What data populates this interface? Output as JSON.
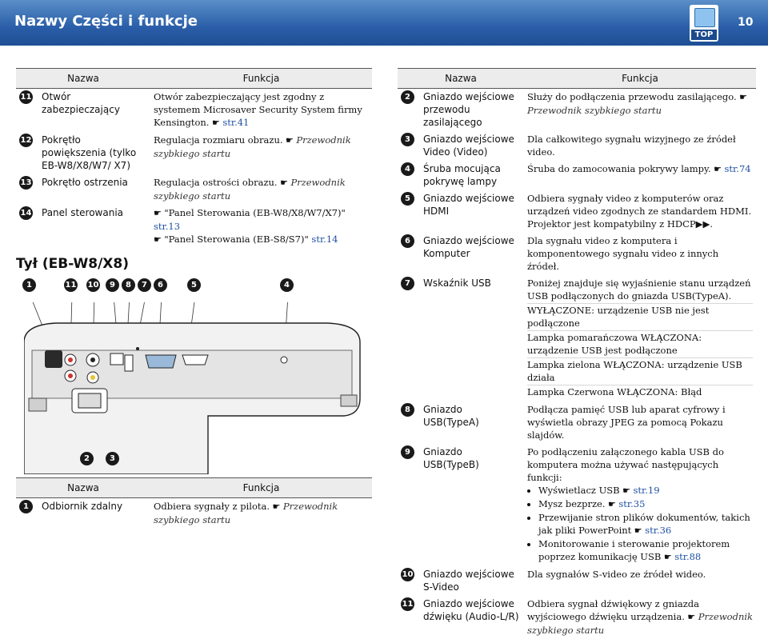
{
  "header": {
    "title": "Nazwy Części i funkcje",
    "page": "10",
    "top_label": "TOP"
  },
  "left_table": {
    "col_name": "Nazwa",
    "col_func": "Funkcja",
    "rows": [
      {
        "num": "11",
        "name": "Otwór zabezpieczający",
        "func": "Otwór zabezpieczający jest zgodny z systemem Microsaver Security System firmy Kensington.",
        "link": "str.41"
      },
      {
        "num": "12",
        "name": "Pokrętło powiększenia (tylko EB-W8/X8/W7/ X7)",
        "func": "Regulacja rozmiaru obrazu.",
        "italic": "Przewodnik szybkiego startu"
      },
      {
        "num": "13",
        "name": "Pokrętło ostrzenia",
        "func": "Regulacja ostrości obrazu.",
        "italic": "Przewodnik szybkiego startu"
      },
      {
        "num": "14",
        "name": "Panel sterowania",
        "func1": "\"Panel Sterowania (EB-W8/X8/W7/X7)\"",
        "link1": "str.13",
        "func2": "\"Panel Sterowania (EB-S8/S7)\"",
        "link2": "str.14"
      }
    ]
  },
  "section_title": "Tył (EB-W8/X8)",
  "callouts": [
    "1",
    "11",
    "10",
    "9",
    "8",
    "7",
    "6",
    "5",
    "4",
    "2",
    "3"
  ],
  "bottom_table": {
    "col_name": "Nazwa",
    "col_func": "Funkcja",
    "rows": [
      {
        "num": "1",
        "name": "Odbiornik zdalny",
        "func": "Odbiera sygnały z pilota.",
        "italic": "Przewodnik szybkiego startu"
      }
    ]
  },
  "right_table": {
    "col_name": "Nazwa",
    "col_func": "Funkcja",
    "rows": [
      {
        "num": "2",
        "name": "Gniazdo wejściowe przewodu zasilającego",
        "func": "Służy do podłączenia przewodu zasilającego.",
        "italic": "Przewodnik szybkiego startu"
      },
      {
        "num": "3",
        "name": "Gniazdo wejściowe Video (Video)",
        "func": "Dla całkowitego sygnału wizyjnego ze źródeł video."
      },
      {
        "num": "4",
        "name": "Śruba mocująca pokrywę lampy",
        "func": "Śruba do zamocowania pokrywy lampy.",
        "link": "str.74"
      },
      {
        "num": "5",
        "name": "Gniazdo wejściowe HDMI",
        "func": "Odbiera sygnały video z komputerów oraz urządzeń video zgodnych ze standardem HDMI. Projektor jest kompatybilny z HDCP",
        "suffix": "."
      },
      {
        "num": "6",
        "name": "Gniazdo wejściowe Komputer",
        "func": "Dla sygnału video z komputera i komponentowego sygnału video z innych źródeł."
      },
      {
        "num": "7",
        "name": "Wskaźnik USB",
        "subs": [
          "Poniżej znajduje się wyjaśnienie stanu urządzeń USB podłączonych do gniazda USB(TypeA).",
          "WYŁĄCZONE: urządzenie USB nie jest podłączone",
          "Lampka pomarańczowa WŁĄCZONA: urządzenie USB jest podłączone",
          "Lampka zielona WŁĄCZONA: urządzenie USB działa",
          "Lampka Czerwona WŁĄCZONA: Błąd"
        ]
      },
      {
        "num": "8",
        "name": "Gniazdo USB(TypeA)",
        "func": "Podłącza pamięć USB lub aparat cyfrowy i wyświetla obrazy JPEG za pomocą Pokazu slajdów."
      },
      {
        "num": "9",
        "name": "Gniazdo USB(TypeB)",
        "func": "Po podłączeniu załączonego kabla USB do komputera można używać następujących funkcji:",
        "bullets": [
          {
            "text": "Wyświetlacz USB",
            "link": "str.19"
          },
          {
            "text": "Mysz bezprze.",
            "link": "str.35"
          },
          {
            "text": "Przewijanie stron plików dokumentów, takich jak pliki PowerPoint",
            "link": "str.36"
          },
          {
            "text": "Monitorowanie i sterowanie projektorem poprzez komunikację USB",
            "link": "str.88"
          }
        ]
      },
      {
        "num": "10",
        "name": "Gniazdo wejściowe S-Video",
        "func": "Dla sygnałów S-video ze źródeł wideo."
      },
      {
        "num": "11",
        "name": "Gniazdo wejściowe dźwięku (Audio-L/R)",
        "func": "Odbiera sygnał dźwiękowy z gniazda wyjściowego dźwięku urządzenia.",
        "italic": "Przewodnik szybkiego startu"
      }
    ]
  }
}
